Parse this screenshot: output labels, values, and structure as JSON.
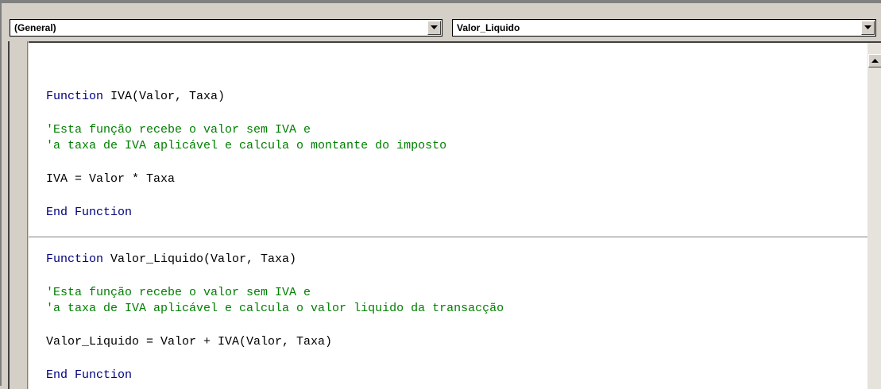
{
  "object_combo": {
    "value": "(General)"
  },
  "procedure_combo": {
    "value": "Valor_Liquido"
  },
  "icons": {
    "dropdown": "chevron-down-icon",
    "scroll_up": "arrow-up-icon"
  },
  "colors": {
    "keyword": "#00007f",
    "comment": "#008000",
    "code": "#000000",
    "chrome": "#d4d0c8"
  },
  "code": {
    "function1": {
      "kw_function": "Function",
      "signature": " IVA(Valor, Taxa)",
      "comment1": "'Esta função recebe o valor sem IVA e",
      "comment2": "'a taxa de IVA aplicável e calcula o montante do imposto",
      "statement": "IVA = Valor * Taxa",
      "kw_end": "End Function"
    },
    "function2": {
      "kw_function": "Function",
      "signature": " Valor_Liquido(Valor, Taxa)",
      "comment1": "'Esta função recebe o valor sem IVA e",
      "comment2": "'a taxa de IVA aplicável e calcula o valor liquido da transacção",
      "statement": "Valor_Liquido = Valor + IVA(Valor, Taxa)",
      "kw_end": "End Function"
    }
  }
}
